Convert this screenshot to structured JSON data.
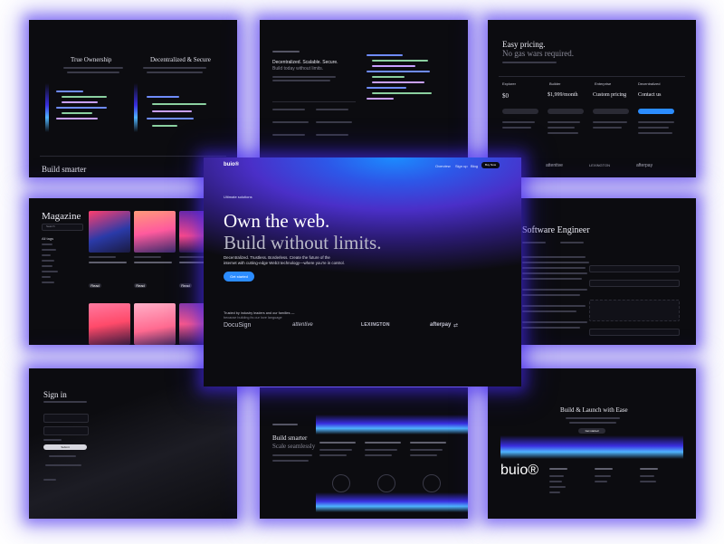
{
  "tiles": {
    "ownership": {
      "col1_title": "True Ownership",
      "col2_title": "Decentralized & Secure",
      "footer_title": "Build smarter"
    },
    "code": {
      "title_line1": "Decentralized. Scalable. Secure.",
      "title_line2": "Build today without limits."
    },
    "pricing": {
      "title_line1": "Easy pricing.",
      "title_line2": "No gas wars required.",
      "plans": [
        "Explorer",
        "Builder",
        "Enterprise",
        "Decentralized"
      ],
      "prices": [
        "$0",
        "$1,999/month",
        "Custom pricing",
        "Contact us"
      ],
      "logos": [
        "attentive",
        "LEXINGTON",
        "afterpay"
      ]
    },
    "magazine": {
      "title": "Magazine",
      "search": "Search",
      "filter": "All tags",
      "read_label": "Read"
    },
    "career": {
      "title": "Software Engineer"
    },
    "signin": {
      "title": "Sign in",
      "button": "Submit"
    },
    "scale": {
      "title_line1": "Build smarter",
      "title_line2": "Scale seamlessly"
    },
    "footer": {
      "title": "Build & Launch with Ease",
      "button": "Get started",
      "logo": "buio®"
    }
  },
  "hero": {
    "logo": "buio®",
    "nav": [
      "Overview",
      "Sign up",
      "Blog"
    ],
    "nav_cta": "Buy Now",
    "eyebrow": "Ultimate solutions",
    "headline_line1": "Own the web.",
    "headline_line2": "Build without limits.",
    "subtitle_line1": "Decentralized. Trustless. Borderless. Create the future of the",
    "subtitle_line2": "internet with cutting-edge Web3 technology—where you're in control.",
    "cta": "Get started",
    "trusted_line1": "Trusted by industry leaders and our families —",
    "trusted_line2": "because building its our love language",
    "logos": [
      "DocuSign",
      "attentive",
      "LEXINGTON",
      "afterpay"
    ]
  },
  "colors": {
    "accent": "#2b8cff",
    "glow": "#4a3cf0",
    "background": "#0c0c10"
  }
}
